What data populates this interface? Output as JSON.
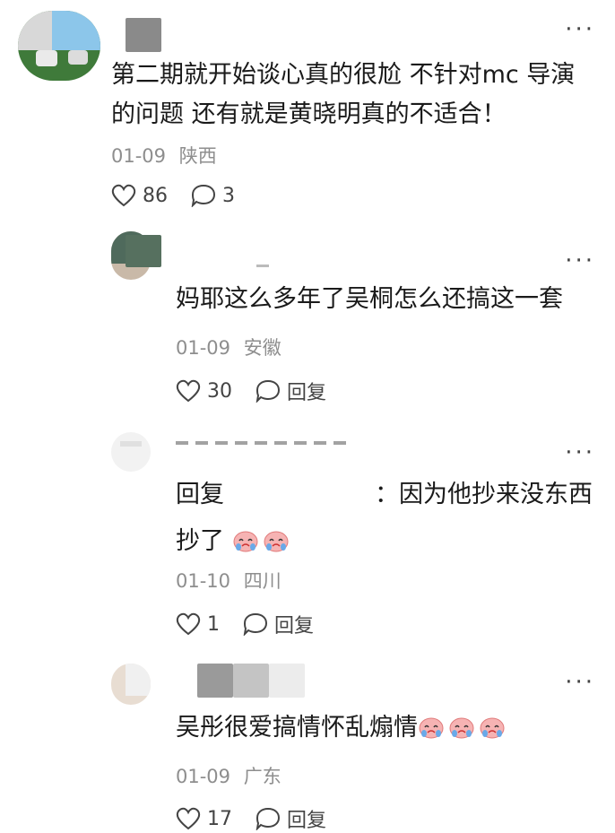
{
  "comments": [
    {
      "text": "第二期就开始谈心真的很尬 不针对mc 导演的问题 还有就是黄晓明真的不适合！",
      "line1": "第二期就开始谈心真的很尬 不针对mc 导演",
      "line2": "的问题 还有就是黄晓明真的不适合！",
      "date": "01-09",
      "location": "陕西",
      "likes": "86",
      "replies": "3"
    },
    {
      "text": "妈耶这么多年了吴桐怎么还搞这一套",
      "date": "01-09",
      "location": "安徽",
      "likes": "30",
      "reply_label": "回复"
    },
    {
      "reply_prefix": "回复",
      "text_line1": "：因为他抄来没东西",
      "text_line2": "抄了",
      "date": "01-10",
      "location": "四川",
      "likes": "1",
      "reply_label": "回复"
    },
    {
      "text": "吴彤很爱搞情怀乱煽情",
      "date": "01-09",
      "location": "广东",
      "likes": "17",
      "reply_label": "回复"
    }
  ],
  "icons": {
    "more": "more-dots-icon",
    "like": "heart-icon",
    "comment": "comment-bubble-icon",
    "emoji": "crying-face-emoji"
  },
  "colors": {
    "text": "#1a1a1a",
    "meta": "#8e8e8e",
    "icon": "#444444"
  }
}
